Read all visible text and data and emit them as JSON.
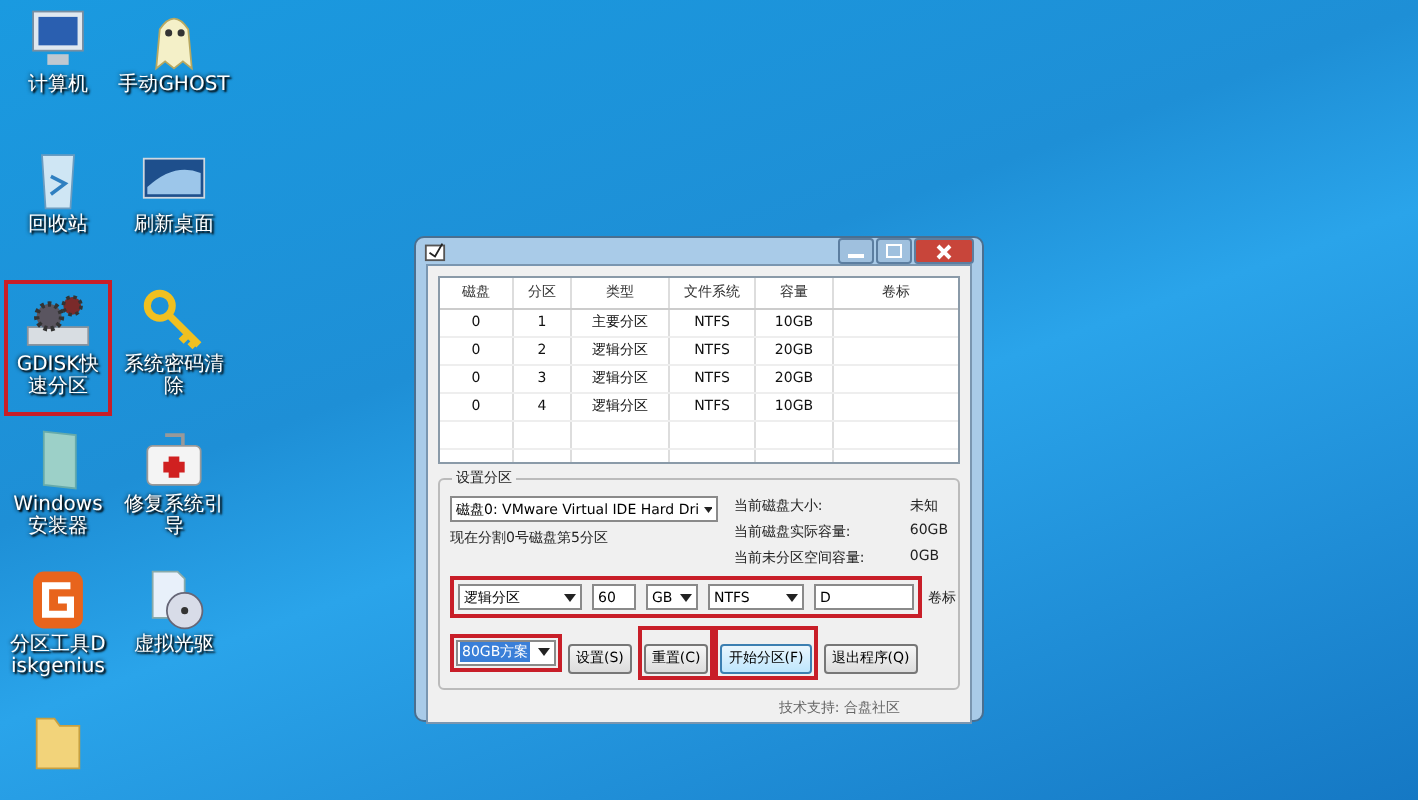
{
  "desktop_icons": [
    {
      "label": "计算机",
      "kind": "computer",
      "highlighted": false
    },
    {
      "label": "手动GHOST",
      "kind": "ghost",
      "highlighted": false
    },
    {
      "label": "回收站",
      "kind": "recycle",
      "highlighted": false
    },
    {
      "label": "刷新桌面",
      "kind": "monitor",
      "highlighted": false
    },
    {
      "label": "GDISK快速分区",
      "kind": "gears",
      "highlighted": true
    },
    {
      "label": "系统密码清除",
      "kind": "key",
      "highlighted": false
    },
    {
      "label": "Windows安装器",
      "kind": "installer",
      "highlighted": false
    },
    {
      "label": "修复系统引导",
      "kind": "medkit",
      "highlighted": false
    },
    {
      "label": "分区工具Diskgenius",
      "kind": "diskgenius",
      "highlighted": false
    },
    {
      "label": "虚拟光驱",
      "kind": "disc",
      "highlighted": false
    },
    {
      "kind": "folder",
      "highlighted": false
    }
  ],
  "dialog": {
    "table": {
      "columns": [
        "磁盘",
        "分区",
        "类型",
        "文件系统",
        "容量",
        "卷标"
      ],
      "rows": [
        [
          "0",
          "1",
          "主要分区",
          "NTFS",
          "10GB",
          ""
        ],
        [
          "0",
          "2",
          "逻辑分区",
          "NTFS",
          "20GB",
          ""
        ],
        [
          "0",
          "3",
          "逻辑分区",
          "NTFS",
          "20GB",
          ""
        ],
        [
          "0",
          "4",
          "逻辑分区",
          "NTFS",
          "10GB",
          ""
        ]
      ]
    },
    "settings": {
      "group_title": "设置分区",
      "disk_select": "磁盘0: VMware Virtual IDE Hard Dri",
      "status_text": "现在分割0号磁盘第5分区",
      "info": [
        {
          "label": "当前磁盘大小:",
          "value": "未知"
        },
        {
          "label": "当前磁盘实际容量:",
          "value": "60GB"
        },
        {
          "label": "当前未分区空间容量:",
          "value": "0GB"
        }
      ],
      "partition_row": {
        "highlighted": true,
        "type": "逻辑分区",
        "size": "60",
        "unit": "GB",
        "filesystem": "NTFS",
        "volume_label": "D",
        "volume_label_caption": "卷标"
      },
      "scheme": {
        "value": "80GB方案",
        "highlighted": true
      },
      "buttons": [
        {
          "label": "设置(S)",
          "highlighted": false,
          "default": false
        },
        {
          "label": "重置(C)",
          "highlighted": true,
          "default": false
        },
        {
          "label": "开始分区(F)",
          "highlighted": true,
          "default": true
        },
        {
          "label": "退出程序(Q)",
          "highlighted": false,
          "default": false
        }
      ]
    },
    "footer": "技术支持: 合盘社区"
  }
}
